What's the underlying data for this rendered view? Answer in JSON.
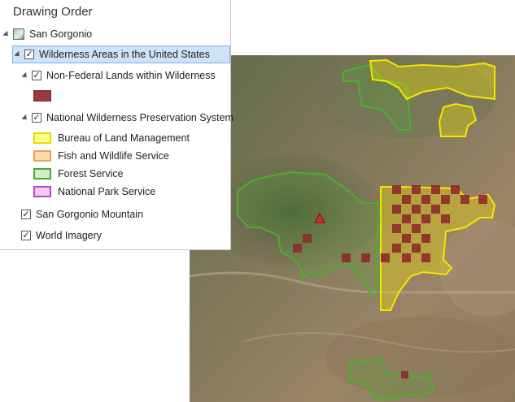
{
  "panel": {
    "title": "Drawing Order",
    "map_name": "San Gorgonio",
    "layers": {
      "wilderness": {
        "label": "Wilderness Areas in the United States",
        "checked": "✓"
      },
      "nonfederal": {
        "label": "Non-Federal Lands within Wilderness",
        "checked": "✓",
        "color": "#9b3a3c"
      },
      "nwps": {
        "label": "National Wilderness Preservation System",
        "checked": "✓"
      },
      "legend": [
        {
          "label": "Bureau of Land Management",
          "fill": "#ffff80",
          "stroke": "#e6d800"
        },
        {
          "label": "Fish and Wildlife Service",
          "fill": "#ffd9a6",
          "stroke": "#e5a35a"
        },
        {
          "label": "Forest Service",
          "fill": "#d2eec6",
          "stroke": "#4fa43b"
        },
        {
          "label": "National Park Service",
          "fill": "#f2ccf5",
          "stroke": "#b24bc9"
        }
      ],
      "mountain": {
        "label": "San Gorgonio Mountain",
        "checked": "✓"
      },
      "imagery": {
        "label": "World Imagery",
        "checked": "✓"
      }
    }
  },
  "map": {
    "colors": {
      "blm": "#f5e600",
      "forest": "#4caf2e",
      "nonfederal": "#8e2a2c",
      "peak": "#d92b2b"
    }
  }
}
